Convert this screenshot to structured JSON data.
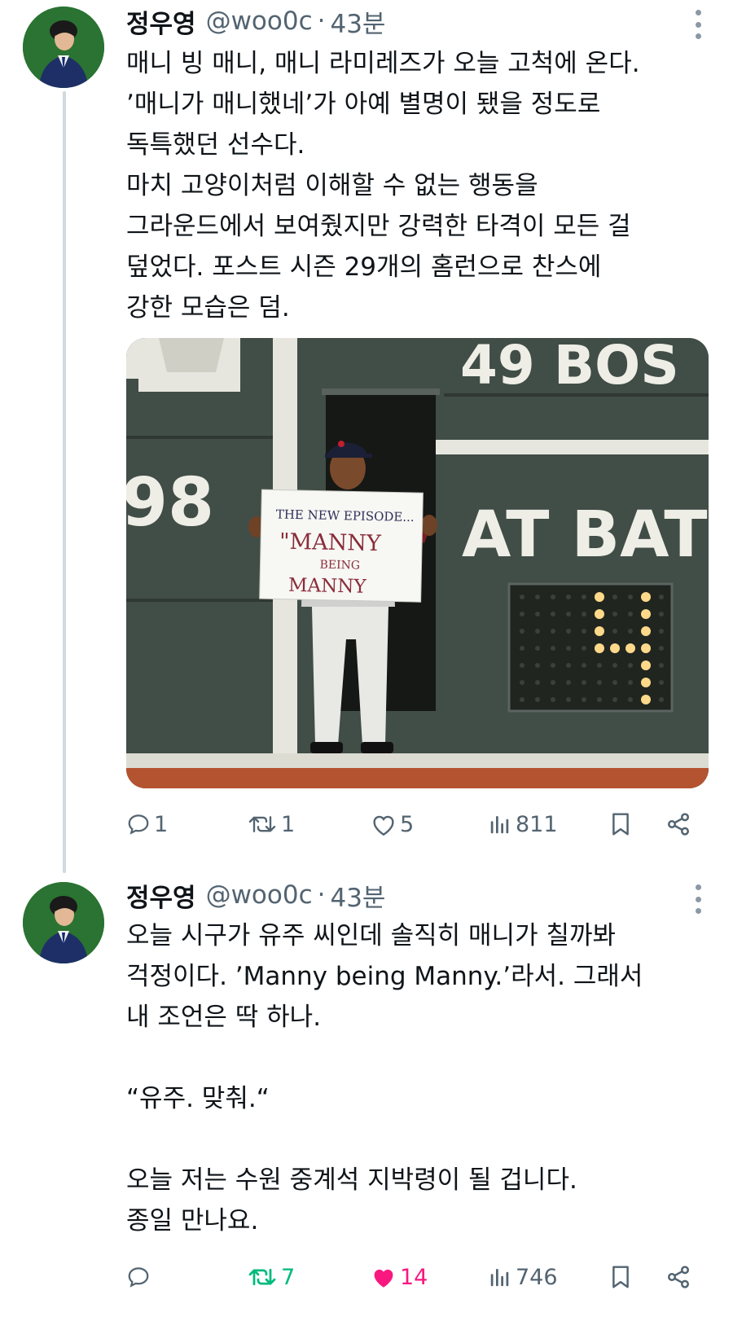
{
  "tweets": [
    {
      "name": "정우영",
      "handle": "@woo0c",
      "separator": "·",
      "time": "43분",
      "lines": [
        "매니 빙 매니, 매니 라미레즈가 오늘 고척에 온다.",
        "’매니가 매니했네’가 아예 별명이 됐을 정도로",
        "독특했던 선수다.",
        "마치 고양이처럼 이해할 수 없는 행동을",
        "그라운드에서 보여줬지만 강력한 타격이 모든 걸",
        "덮었다. 포스트 시즌 29개의 홈런으로 찬스에",
        "강한 모습은 덤."
      ],
      "image": {
        "sign": [
          "THE NEW EPISODE...",
          "\"MANNY",
          "BEING",
          "MANNY"
        ],
        "board": {
          "top_text": "49 BOS",
          "left_number": "98",
          "at_bat": "AT BAT",
          "at_bat_digit": "4"
        }
      },
      "actions": {
        "replies": "1",
        "retweets": "1",
        "likes": "5",
        "views": "811"
      },
      "retweeted": false,
      "liked": false
    },
    {
      "name": "정우영",
      "handle": "@woo0c",
      "separator": "·",
      "time": "43분",
      "lines": [
        "오늘 시구가 유주 씨인데 솔직히 매니가 칠까봐",
        "걱정이다. ’Manny being Manny.’라서. 그래서",
        "내 조언은 딱 하나.",
        "",
        "“유주. 맞춰.“",
        "",
        "오늘 저는 수원 중계석 지박령이 될 겁니다.",
        "종일 만나요."
      ],
      "actions": {
        "replies": "",
        "retweets": "7",
        "likes": "14",
        "views": "746"
      },
      "retweeted": true,
      "liked": true
    }
  ],
  "colors": {
    "muted": "#536471",
    "text": "#0f1419",
    "retweet_active": "#00ba7c",
    "like_active": "#f91880",
    "thread_line": "#cfd9de",
    "wall_green": "#45504a"
  },
  "icons": [
    "reply-icon",
    "retweet-icon",
    "like-icon",
    "views-icon",
    "bookmark-icon",
    "share-icon",
    "more-icon"
  ]
}
